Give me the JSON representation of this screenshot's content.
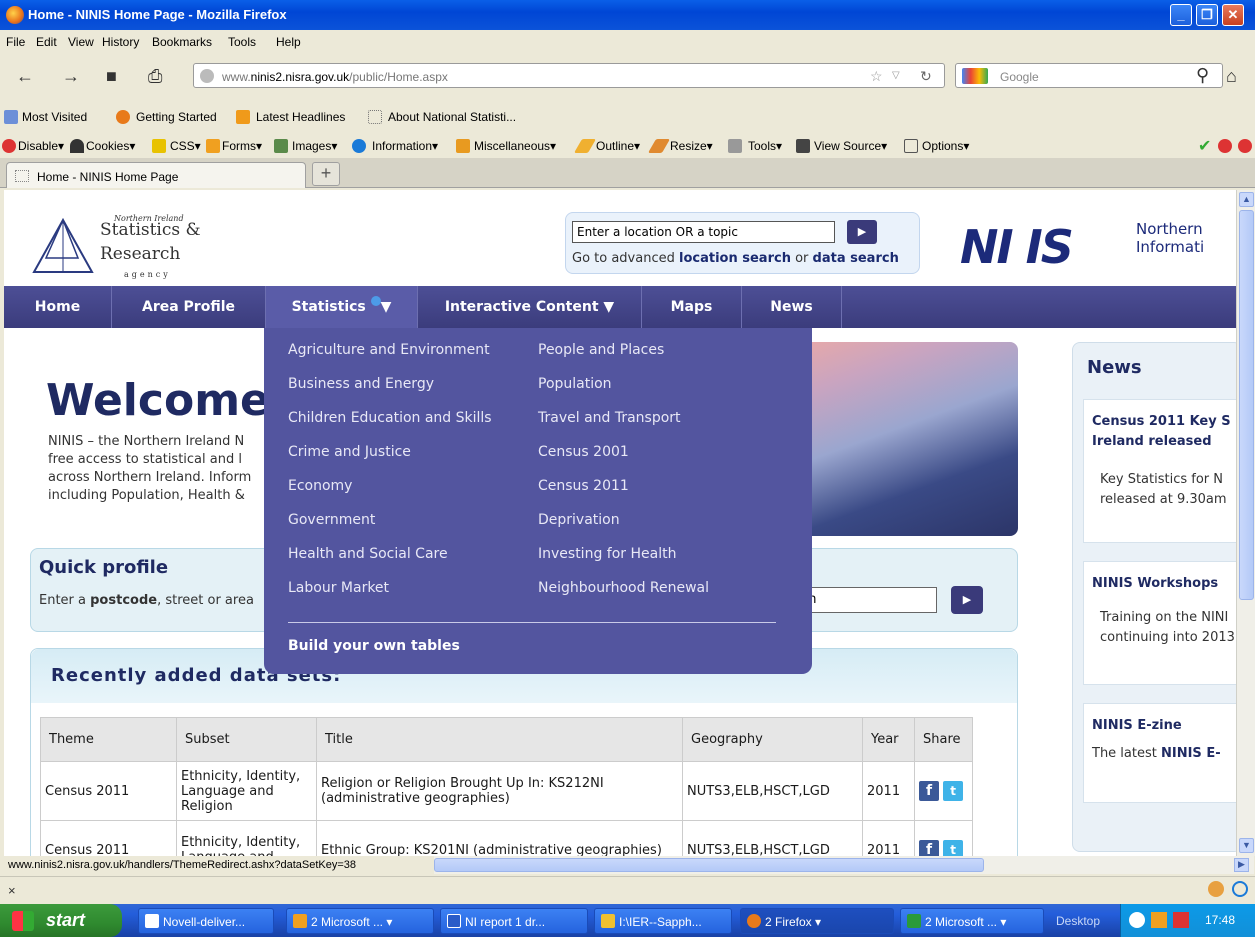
{
  "window": {
    "title": "Home - NINIS Home Page - Mozilla Firefox"
  },
  "menubar": [
    "File",
    "Edit",
    "View",
    "History",
    "Bookmarks",
    "Tools",
    "Help"
  ],
  "navbar": {
    "url_prefix": "www.",
    "url_domain": "ninis2.nisra.gov.uk",
    "url_path": "/public/Home.aspx",
    "search_placeholder": "Google"
  },
  "bookmarks": [
    "Most Visited",
    "Getting Started",
    "Latest Headlines",
    "About National Statisti..."
  ],
  "devtoolbar": [
    "Disable▾",
    "Cookies▾",
    "CSS▾",
    "Forms▾",
    "Images▾",
    "Information▾",
    "Miscellaneous▾",
    "Outline▾",
    "Resize▾",
    "Tools▾",
    "View Source▾",
    "Options▾"
  ],
  "tabs": [
    {
      "label": "Home - NINIS Home Page"
    }
  ],
  "newtab": "+",
  "site": {
    "logo": {
      "small": "Northern Ireland",
      "line1": "Statistics &",
      "line2": "Research",
      "agency": "agency"
    },
    "search": {
      "placeholder": "Enter a location OR a topic",
      "hint_pre": "Go to advanced ",
      "hint_loc": "location search",
      "hint_mid": " or ",
      "hint_data": "data search",
      "go": "▶"
    },
    "ninis": {
      "mark": "NI IS",
      "tag1": "Northern",
      "tag2": "Informati"
    },
    "nav": [
      "Home",
      "Area Profile",
      "Statistics",
      "Interactive Content ▼",
      "Maps",
      "News"
    ],
    "nav_stats_arrow": "▼",
    "welcome": "Welcome",
    "intro": [
      "NINIS – the Northern Ireland N",
      "free access to statistical and l",
      "across Northern Ireland. Inform",
      "including Population, Health &"
    ],
    "quick": {
      "title": "Quick profile",
      "desc_pre": "Enter a ",
      "desc_bold": "postcode",
      "desc_post": ", street or area",
      "input": "rch",
      "go": "▶"
    },
    "recent": {
      "title": "Recently added data sets:"
    },
    "table": {
      "headers": [
        "Theme",
        "Subset",
        "Title",
        "Geography",
        "Year",
        "Share"
      ],
      "rows": [
        [
          "Census 2011",
          "Ethnicity, Identity, Language and Religion",
          "Religion or Religion Brought Up In: KS212NI (administrative geographies)",
          "NUTS3,ELB,HSCT,LGD",
          "2011"
        ],
        [
          "Census 2011",
          "Ethnicity, Identity, Language and",
          "Ethnic Group: KS201NI (administrative geographies)",
          "NUTS3,ELB,HSCT,LGD",
          "2011"
        ]
      ]
    },
    "news": {
      "title": "News",
      "items": [
        {
          "head1": "Census 2011 Key S",
          "head2": "Ireland released",
          "body1": "Key Statistics for N",
          "body2": "released at 9.30am"
        },
        {
          "head1": "NINIS Workshops",
          "body1": "Training on the NINI",
          "body2": "continuing into 2013"
        },
        {
          "head1": "NINIS E-zine",
          "body1_pre": "The latest ",
          "body1_bold": "NINIS E-"
        }
      ]
    },
    "dropdown": {
      "col1": [
        "Agriculture and Environment",
        "Business and Energy",
        "Children Education and Skills",
        "Crime and Justice",
        "Economy",
        "Government",
        "Health and Social Care",
        "Labour Market"
      ],
      "col2": [
        "People and Places",
        "Population",
        "Travel and Transport",
        "Census 2001",
        "Census 2011",
        "Deprivation",
        "Investing for Health",
        "Neighbourhood Renewal"
      ],
      "build": "Build your own tables"
    }
  },
  "status": {
    "url": "www.ninis2.nisra.gov.uk/handlers/ThemeRedirect.ashx?dataSetKey=38"
  },
  "taskbar": {
    "start": "start",
    "tasks": [
      "Novell-deliver...",
      "2 Microsoft ...",
      "NI report 1 dr...",
      "I:\\IER--Sapph...",
      "2 Firefox",
      "2 Microsoft ..."
    ],
    "desktop": "Desktop",
    "clock": "17:48"
  }
}
